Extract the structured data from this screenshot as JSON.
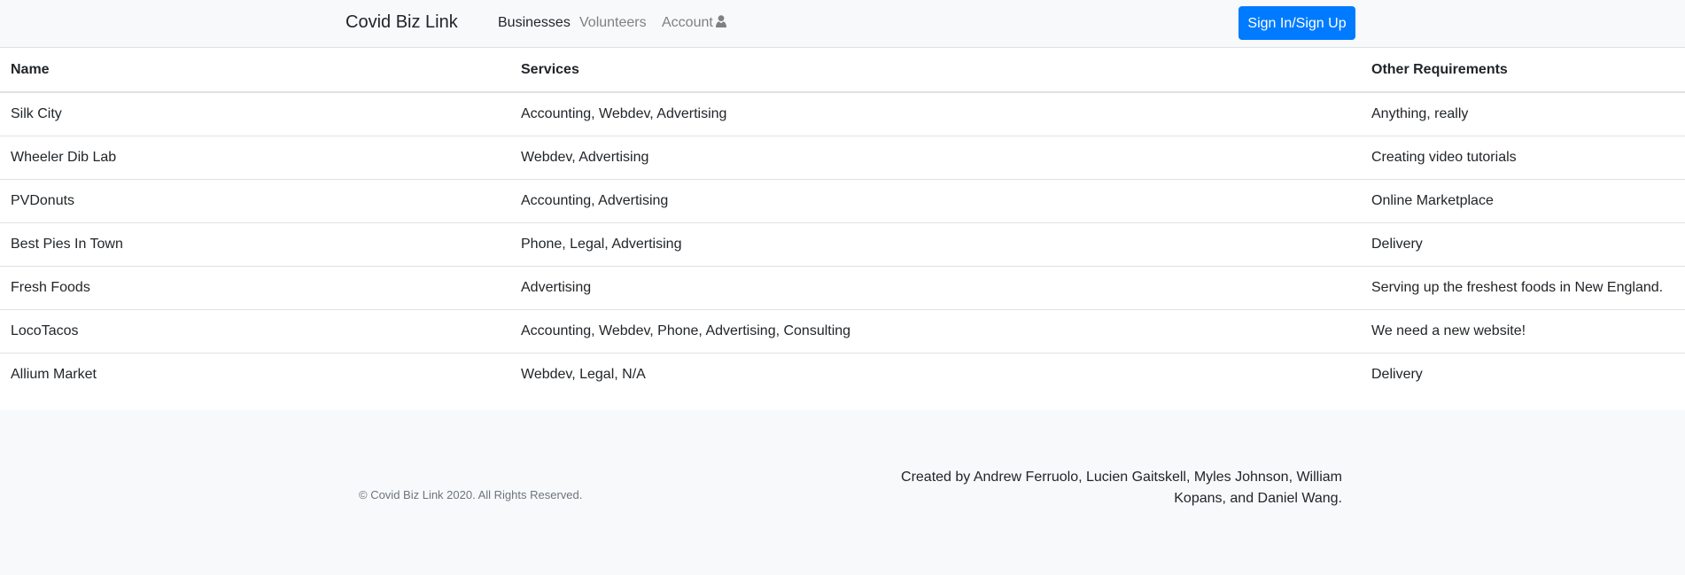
{
  "navbar": {
    "brand": "Covid Biz Link",
    "links": [
      {
        "label": "Businesses",
        "active": true
      },
      {
        "label": "Volunteers",
        "active": false
      },
      {
        "label": "Account",
        "active": false,
        "icon": "user-icon"
      }
    ],
    "signin_label": "Sign In/Sign Up",
    "accent_color": "#007bff"
  },
  "table": {
    "headers": [
      "Name",
      "Services",
      "Other Requirements"
    ],
    "rows": [
      [
        "Silk City",
        "Accounting, Webdev, Advertising",
        "Anything, really"
      ],
      [
        "Wheeler Dib Lab",
        "Webdev, Advertising",
        "Creating video tutorials"
      ],
      [
        "PVDonuts",
        "Accounting, Advertising",
        "Online Marketplace"
      ],
      [
        "Best Pies In Town",
        "Phone, Legal, Advertising",
        "Delivery"
      ],
      [
        "Fresh Foods",
        "Advertising",
        "Serving up the freshest foods in New England."
      ],
      [
        "LocoTacos",
        "Accounting, Webdev, Phone, Advertising, Consulting",
        "We need a new website!"
      ],
      [
        "Allium Market",
        "Webdev, Legal, N/A",
        "Delivery"
      ]
    ]
  },
  "footer": {
    "copyright": "© Covid Biz Link 2020. All Rights Reserved.",
    "credits_line1": "Created by Andrew Ferruolo,  Lucien Gaitskell, Myles Johnson, William",
    "credits_line2": "Kopans,  and Daniel Wang."
  }
}
